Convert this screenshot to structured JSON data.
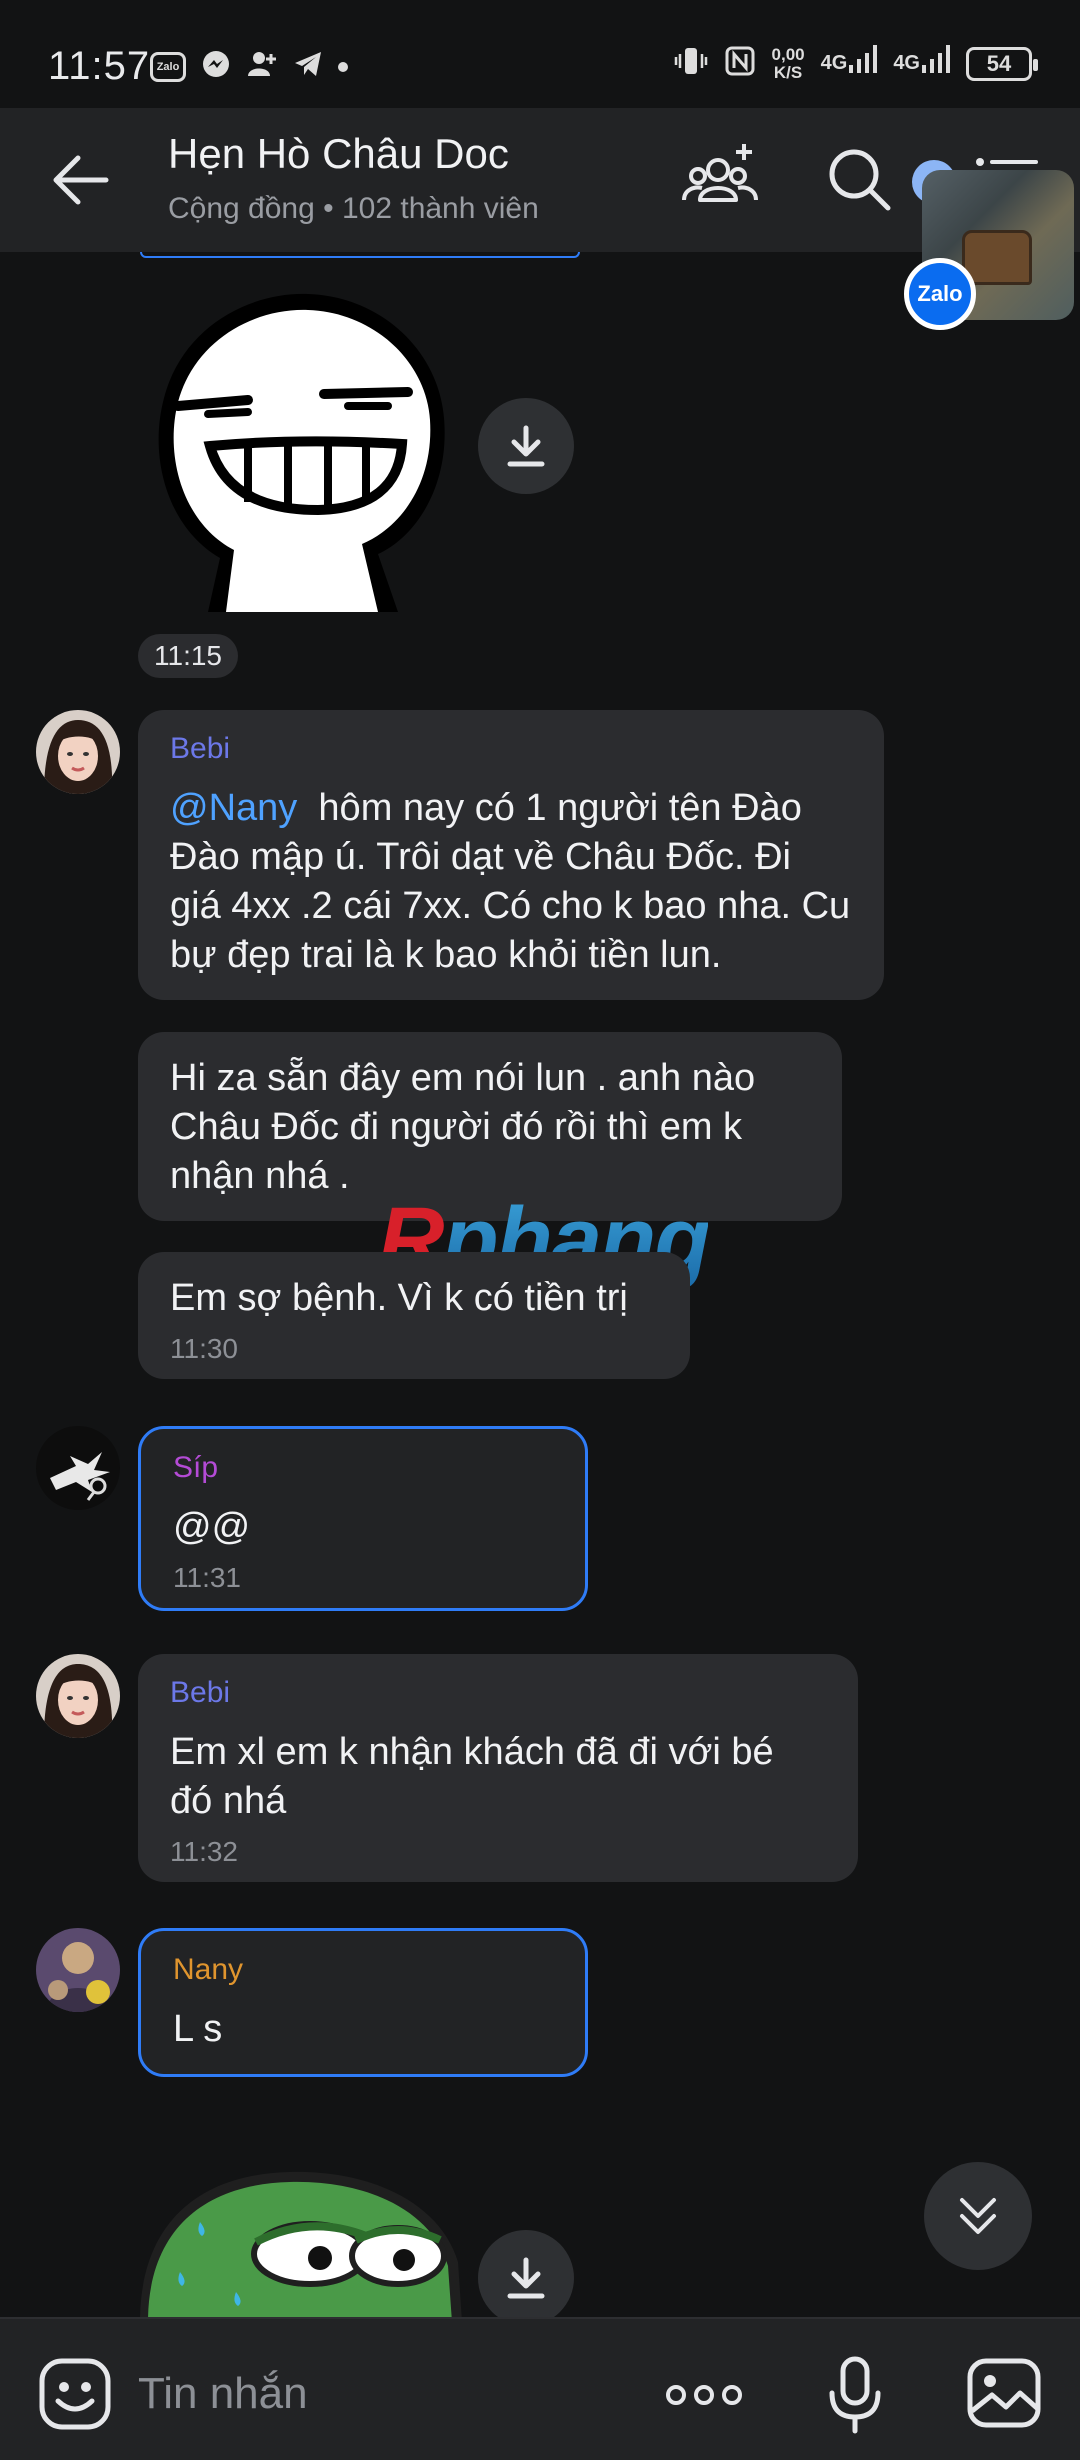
{
  "status_bar": {
    "time": "11:57",
    "zalo_label": "Zalo",
    "speed_value": "0,00",
    "speed_unit": "K/S",
    "net1": "4G",
    "net2": "4G",
    "battery": "54"
  },
  "header": {
    "title": "Hẹn Hò Châu Doc",
    "subtitle": "Cộng đồng • 102 thành viên",
    "bubble_badge": "Zalo"
  },
  "chat": {
    "sticker1_time": "11:15",
    "watermark": "Rphang",
    "messages": [
      {
        "sender": "Bebi",
        "sender_color": "#6c78e8",
        "mention": "@Nany",
        "text": "hôm nay có 1 người tên Đào Đào mập ú. Trôi dạt về Châu Đốc. Đi giá 4xx .2 cái 7xx. Có cho k bao nha. Cu bự đẹp trai là k bao khỏi tiền lun."
      },
      {
        "text": "Hi za sẵn đây em nói lun . anh nào Châu Đốc đi người đó rồi thì em k nhận nhá ."
      },
      {
        "text": "Em sợ bệnh. Vì k có tiền trị",
        "time": "11:30"
      },
      {
        "sender": "Síp",
        "sender_color": "#b44bd6",
        "text": "@@",
        "time": "11:31"
      },
      {
        "sender": "Bebi",
        "sender_color": "#6c78e8",
        "text": "Em xl em k nhận khách đã đi với bé đó nhá",
        "time": "11:32"
      },
      {
        "sender": "Nany",
        "sender_color": "#e0952e",
        "text": "L s"
      }
    ]
  },
  "composer": {
    "placeholder": "Tin nhắn"
  },
  "colors": {
    "background": "#121314",
    "bubble": "#2b2c2f",
    "accent": "#2f7cf7"
  },
  "icons": [
    "back-arrow-icon",
    "add-member-icon",
    "search-icon",
    "menu-icon",
    "download-icon",
    "chevron-double-down-icon",
    "emoji-icon",
    "more-icon",
    "microphone-icon",
    "gallery-icon"
  ]
}
